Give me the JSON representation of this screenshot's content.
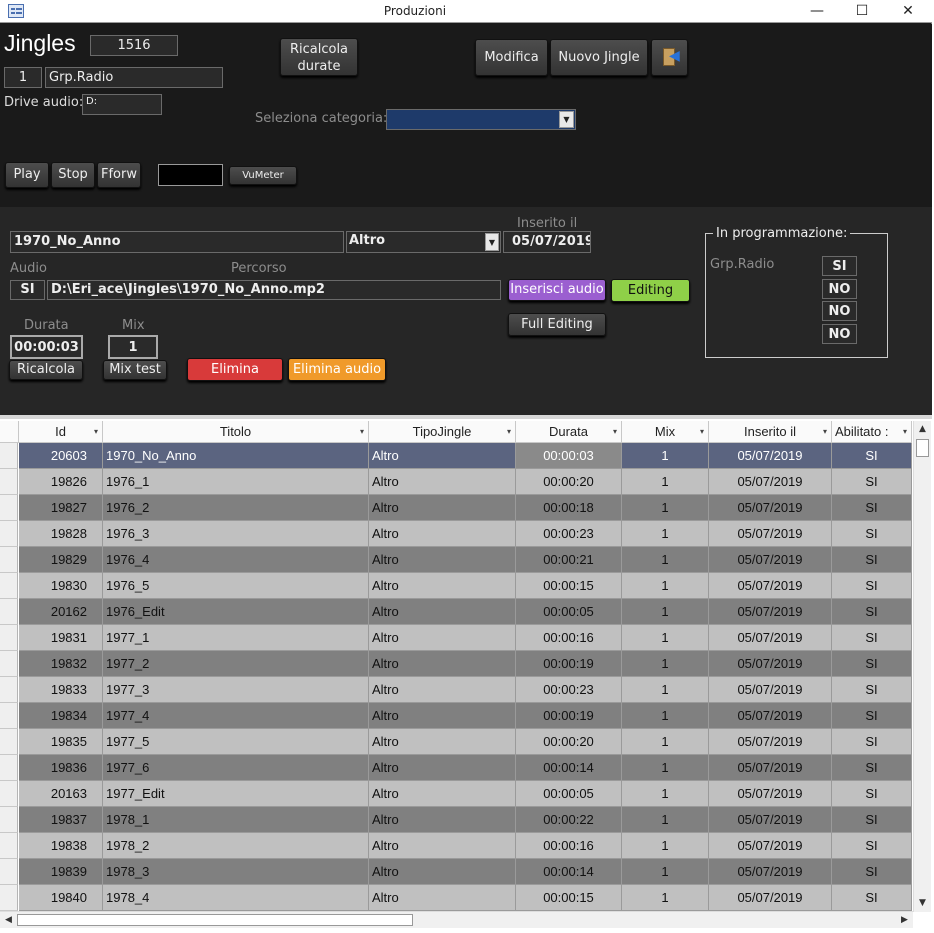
{
  "window": {
    "title": "Produzioni",
    "minimize": "—",
    "maximize": "☐",
    "close": "✕"
  },
  "top": {
    "heading": "Jingles",
    "count": "1516",
    "group_id": "1",
    "group_name": "Grp.Radio",
    "drive_label": "Drive audio:",
    "drive_value": "D:",
    "recalc_line1": "Ricalcola",
    "recalc_line2": "durate",
    "modifica": "Modifica",
    "nuovo": "Nuovo Jingle",
    "category_label": "Seleziona categoria:",
    "category_value": "",
    "play": "Play",
    "stop": "Stop",
    "fforw": "Fforw",
    "vumeter": "VuMeter"
  },
  "detail": {
    "title_value": "1970_No_Anno",
    "type_value": "Altro",
    "inserted_label": "Inserito il",
    "inserted_value": "05/07/2019",
    "audio_label": "Audio",
    "audio_value": "SI",
    "path_label": "Percorso",
    "path_value": "D:\\Eri_ace\\Jingles\\1970_No_Anno.mp2",
    "inserisci_audio": "Inserisci audio",
    "editing": "Editing",
    "full_editing": "Full Editing",
    "durata_label": "Durata",
    "durata_value": "00:00:03",
    "mix_label": "Mix",
    "mix_value": "1",
    "ricalcola": "Ricalcola",
    "mix_test": "Mix test",
    "elimina": "Elimina",
    "elimina_audio": "Elimina audio",
    "prog_title": "In programmazione:",
    "prog_group": "Grp.Radio",
    "prog_values": [
      "SI",
      "NO",
      "NO",
      "NO"
    ]
  },
  "table": {
    "columns": [
      "Id",
      "Titolo",
      "TipoJingle",
      "Durata",
      "Mix",
      "Inserito il",
      "Abilitato :"
    ],
    "rows": [
      [
        "20603",
        "1970_No_Anno",
        "Altro",
        "00:00:03",
        "1",
        "05/07/2019",
        "SI"
      ],
      [
        "19826",
        "1976_1",
        "Altro",
        "00:00:20",
        "1",
        "05/07/2019",
        "SI"
      ],
      [
        "19827",
        "1976_2",
        "Altro",
        "00:00:18",
        "1",
        "05/07/2019",
        "SI"
      ],
      [
        "19828",
        "1976_3",
        "Altro",
        "00:00:23",
        "1",
        "05/07/2019",
        "SI"
      ],
      [
        "19829",
        "1976_4",
        "Altro",
        "00:00:21",
        "1",
        "05/07/2019",
        "SI"
      ],
      [
        "19830",
        "1976_5",
        "Altro",
        "00:00:15",
        "1",
        "05/07/2019",
        "SI"
      ],
      [
        "20162",
        "1976_Edit",
        "Altro",
        "00:00:05",
        "1",
        "05/07/2019",
        "SI"
      ],
      [
        "19831",
        "1977_1",
        "Altro",
        "00:00:16",
        "1",
        "05/07/2019",
        "SI"
      ],
      [
        "19832",
        "1977_2",
        "Altro",
        "00:00:19",
        "1",
        "05/07/2019",
        "SI"
      ],
      [
        "19833",
        "1977_3",
        "Altro",
        "00:00:23",
        "1",
        "05/07/2019",
        "SI"
      ],
      [
        "19834",
        "1977_4",
        "Altro",
        "00:00:19",
        "1",
        "05/07/2019",
        "SI"
      ],
      [
        "19835",
        "1977_5",
        "Altro",
        "00:00:20",
        "1",
        "05/07/2019",
        "SI"
      ],
      [
        "19836",
        "1977_6",
        "Altro",
        "00:00:14",
        "1",
        "05/07/2019",
        "SI"
      ],
      [
        "20163",
        "1977_Edit",
        "Altro",
        "00:00:05",
        "1",
        "05/07/2019",
        "SI"
      ],
      [
        "19837",
        "1978_1",
        "Altro",
        "00:00:22",
        "1",
        "05/07/2019",
        "SI"
      ],
      [
        "19838",
        "1978_2",
        "Altro",
        "00:00:16",
        "1",
        "05/07/2019",
        "SI"
      ],
      [
        "19839",
        "1978_3",
        "Altro",
        "00:00:14",
        "1",
        "05/07/2019",
        "SI"
      ],
      [
        "19840",
        "1978_4",
        "Altro",
        "00:00:15",
        "1",
        "05/07/2019",
        "SI"
      ]
    ]
  },
  "colors": {
    "row_dark": "#808080",
    "row_light": "#c0c0c0",
    "row_selected": "#5b6480",
    "editing_green": "#8fd048",
    "inserisci_purple": "#9b5fd0",
    "elimina_red": "#d83a3a",
    "elimina_audio_orange": "#f09a2a"
  }
}
